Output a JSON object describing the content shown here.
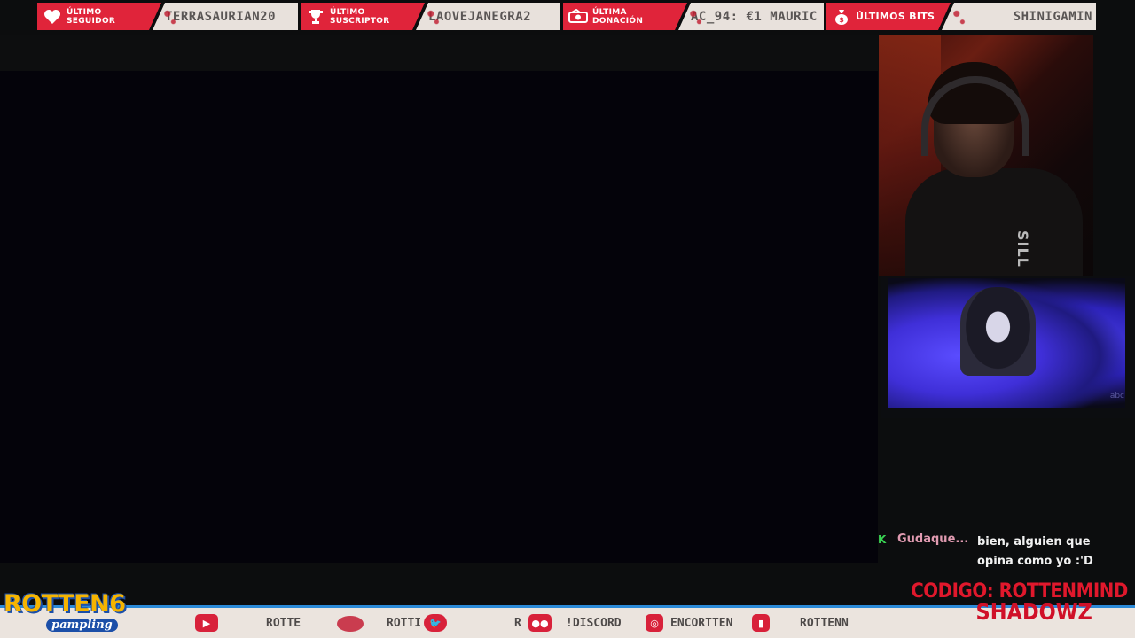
{
  "alerts": [
    {
      "label_line1": "ÚLTIMO",
      "label_line2": "SEGUIDOR",
      "value": "TERRASAURIAN20",
      "icon": "heart-icon"
    },
    {
      "label_line1": "ÚLTIMO",
      "label_line2": "SUSCRIPTOR",
      "value": "LAOVEJANEGRA2",
      "icon": "trophy-icon"
    },
    {
      "label_line1": "ÚLTIMA",
      "label_line2": "DONACIÓN",
      "value": "AC_94: €1   MAURIC",
      "icon": "money-icon"
    },
    {
      "label_line1": "ÚLTIMOS BITS",
      "label_line2": "",
      "value": "SHINIGAMIN",
      "icon": "moneybag-icon"
    }
  ],
  "webcam": {
    "shirt_text": "SILL"
  },
  "clip": {
    "watermark": "abc"
  },
  "chat": {
    "badge": "K",
    "username": "Gudaque...",
    "message": "bien, alguien que opina como yo :'D",
    "colors": {
      "username": "#e09ab0",
      "badge": "#39d353"
    }
  },
  "logo": {
    "title": "ROTTEN6",
    "subtitle": "pampling"
  },
  "bottom_bar": {
    "items": [
      {
        "icon": "youtube-icon",
        "text": ""
      },
      {
        "icon": "",
        "text": "ROTTE"
      },
      {
        "icon": "",
        "text": "ROTTI"
      },
      {
        "icon": "twitter-icon",
        "text": ""
      },
      {
        "icon": "",
        "text": "R"
      },
      {
        "icon": "discord-icon",
        "text": "!DISCORD"
      },
      {
        "icon": "instagram-icon",
        "text": "ENCORTTEN"
      },
      {
        "icon": "twitch-icon",
        "text": "ROTTENN"
      }
    ]
  },
  "promo": {
    "line1": "CODIGO: ROTTENMIND",
    "line2": "SHADOWZ"
  },
  "colors": {
    "accent_red": "#e0243a",
    "bar_light": "#ebe4de",
    "logo_yellow": "#f6b400",
    "logo_blue": "#1c4fa8"
  }
}
